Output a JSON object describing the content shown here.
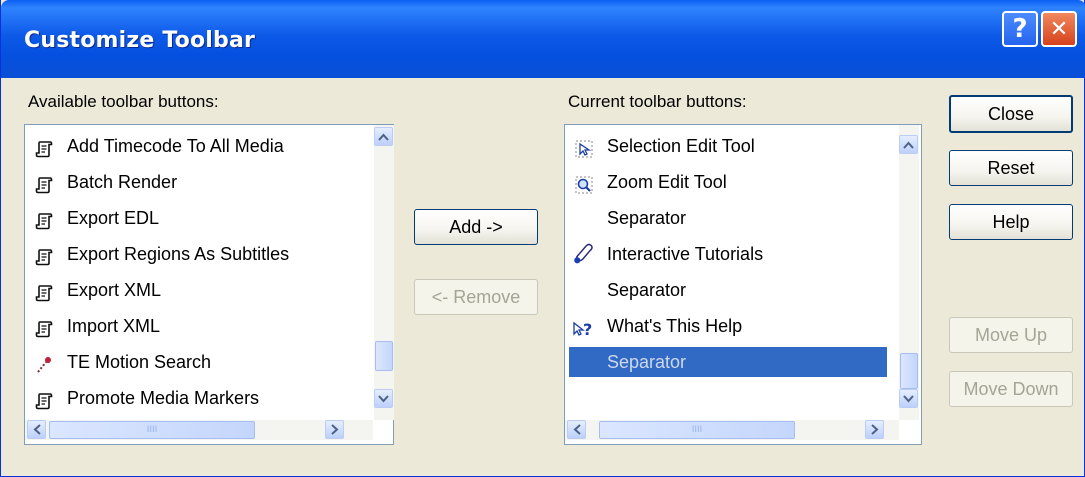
{
  "window": {
    "title": "Customize Toolbar",
    "help_glyph": "?",
    "close_glyph": "✕"
  },
  "available": {
    "label": "Available toolbar buttons:",
    "items": [
      {
        "label": "Add Timecode To All Media",
        "icon": "script-icon"
      },
      {
        "label": "Batch Render",
        "icon": "script-icon"
      },
      {
        "label": "Export EDL",
        "icon": "script-icon"
      },
      {
        "label": "Export Regions As Subtitles",
        "icon": "script-icon"
      },
      {
        "label": "Export XML",
        "icon": "script-icon"
      },
      {
        "label": "Import XML",
        "icon": "script-icon"
      },
      {
        "label": "TE Motion Search",
        "icon": "motion-search-icon"
      },
      {
        "label": "Promote Media Markers",
        "icon": "script-icon"
      }
    ]
  },
  "current": {
    "label": "Current toolbar buttons:",
    "items": [
      {
        "label": "Selection Edit Tool",
        "icon": "selection-edit-icon"
      },
      {
        "label": "Zoom Edit Tool",
        "icon": "zoom-edit-icon"
      },
      {
        "label": "Separator",
        "icon": ""
      },
      {
        "label": "Interactive Tutorials",
        "icon": "tutorials-icon"
      },
      {
        "label": "Separator",
        "icon": ""
      },
      {
        "label": "What's This Help",
        "icon": "whats-this-help-icon"
      },
      {
        "label": "Separator",
        "icon": "",
        "selected": true
      }
    ]
  },
  "buttons": {
    "add": "Add ->",
    "remove": "<- Remove",
    "close": "Close",
    "reset": "Reset",
    "help": "Help",
    "move_up": "Move Up",
    "move_down": "Move Down"
  },
  "scrollbar": {
    "thumb_grip": "IIII"
  },
  "colors": {
    "titlebar": "#0550e0",
    "face": "#ece9d8",
    "selection": "#316ac5",
    "list_border": "#7f9db9"
  }
}
